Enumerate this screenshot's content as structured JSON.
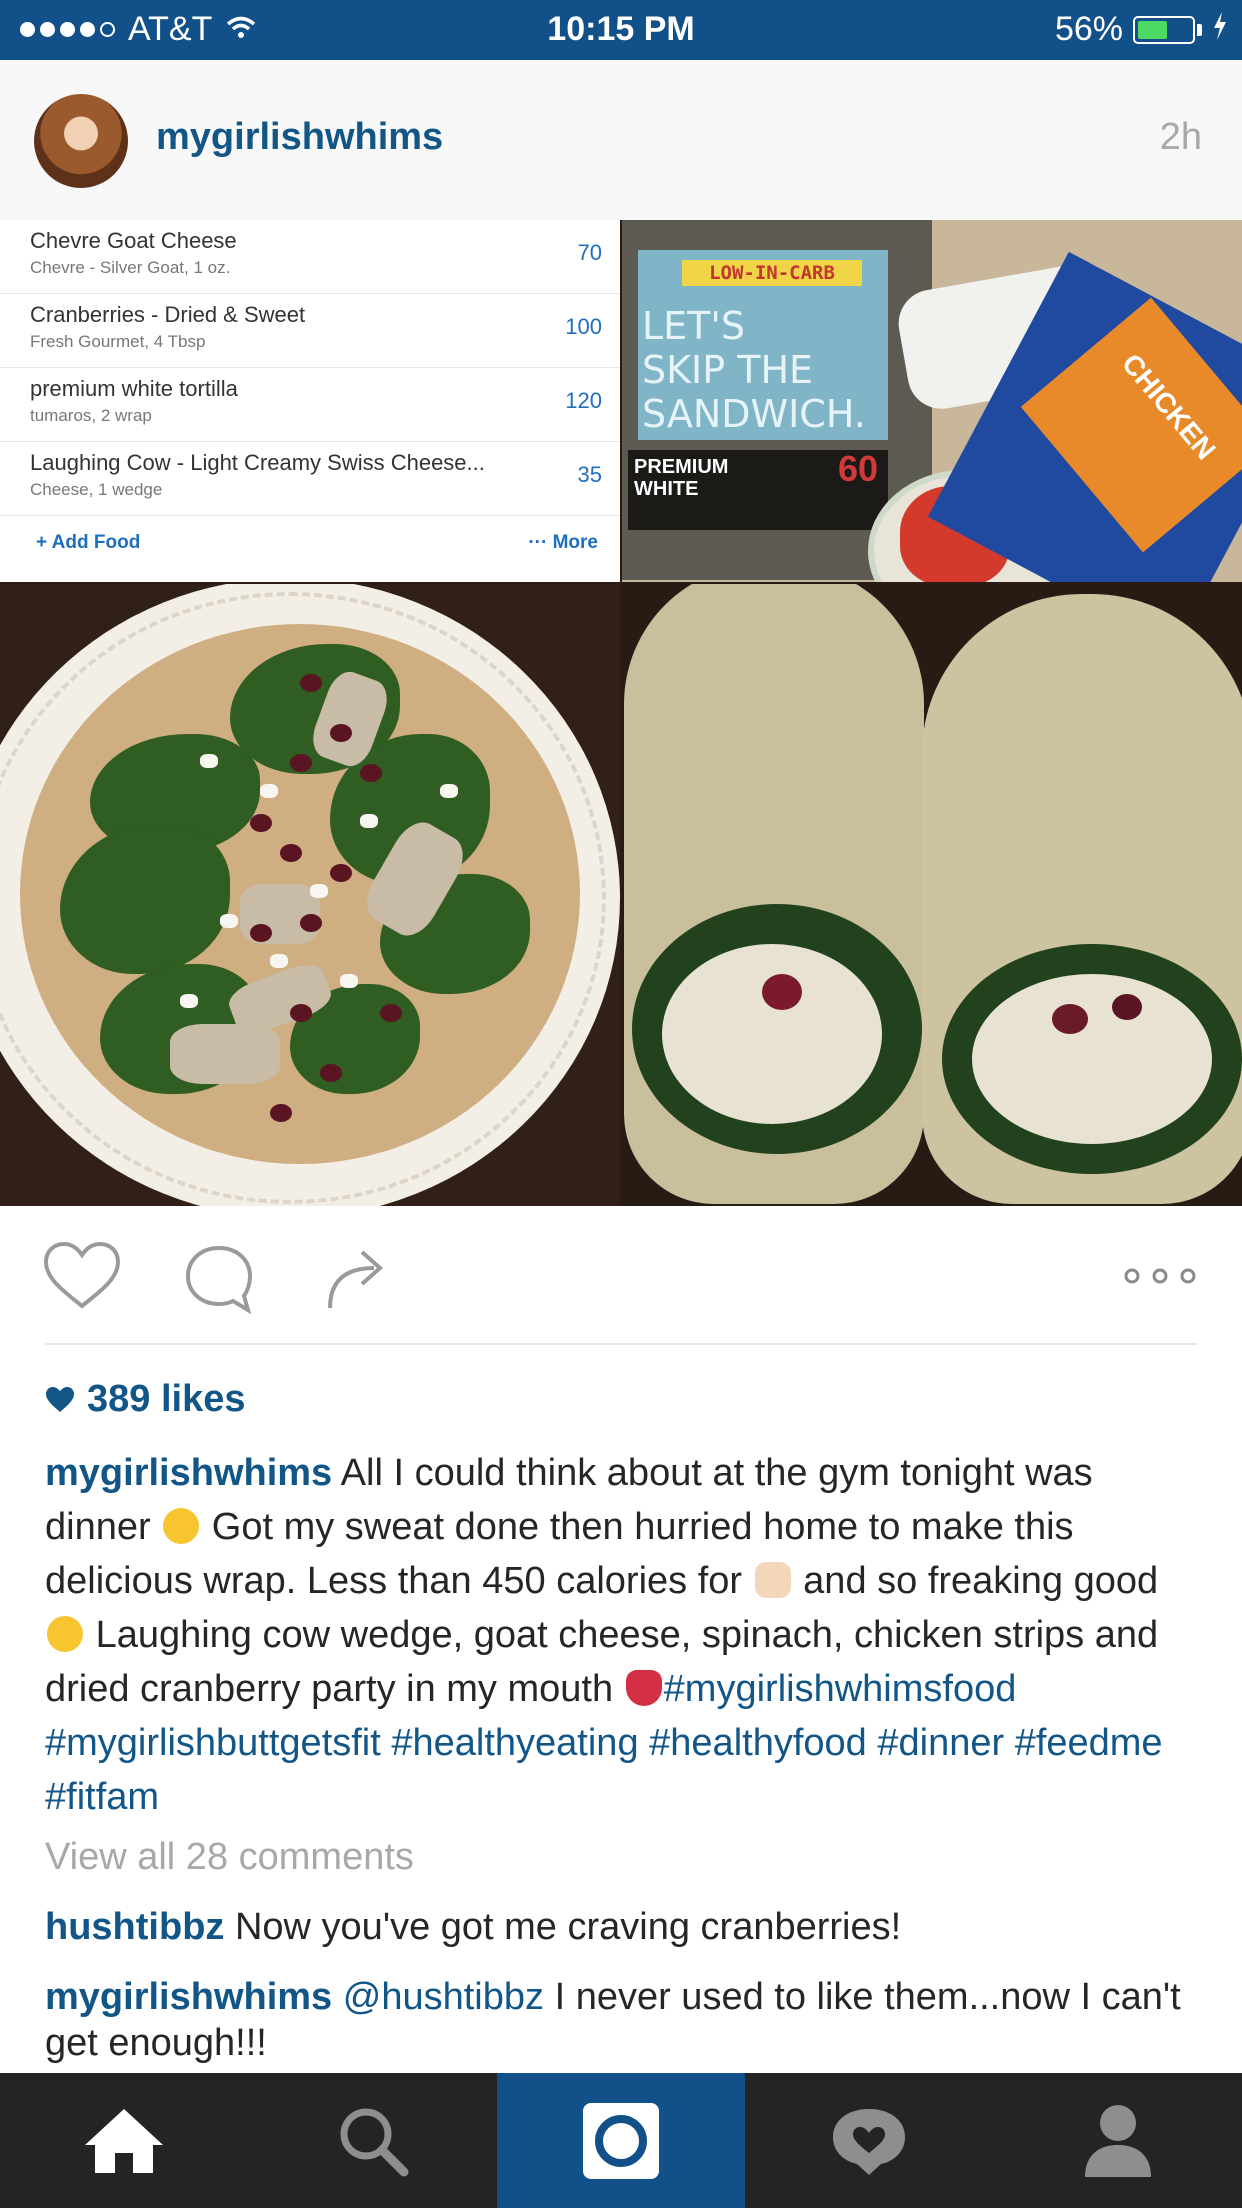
{
  "status_bar": {
    "carrier": "AT&T",
    "time": "10:15 PM",
    "battery_percent": "56%",
    "battery_level": 0.56,
    "signal_dots_filled": 4,
    "signal_dots_total": 5
  },
  "post": {
    "username": "mygirlishwhims",
    "time_ago": "2h"
  },
  "collage": {
    "food_log": [
      {
        "name": "Chevre Goat Cheese",
        "detail": "Chevre - Silver Goat, 1 oz.",
        "calories": "70"
      },
      {
        "name": "Cranberries - Dried & Sweet",
        "detail": "Fresh Gourmet, 4 Tbsp",
        "calories": "100"
      },
      {
        "name": "premium white tortilla",
        "detail": "tumaros, 2 wrap",
        "calories": "120"
      },
      {
        "name": "Laughing Cow - Light Creamy Swiss Cheese...",
        "detail": "Cheese, 1 wedge",
        "calories": "35"
      }
    ],
    "add_food": "+ Add Food",
    "more": "··· More",
    "package_texts": {
      "low_carb": "LOW-IN-CARB",
      "skip_line1": "LET'S",
      "skip_line2": "SKIP THE",
      "skip_line3": "SANDWICH.",
      "premium_line1": "PREMIUM",
      "premium_line2": "WHITE",
      "sixty": "60",
      "chicken": "CHICKEN"
    }
  },
  "actions": {
    "like": "heart-icon",
    "comment": "comment-icon",
    "share": "share-arrow-icon",
    "more": "more-dots-icon"
  },
  "likes": "389 likes",
  "caption": {
    "username": "mygirlishwhims",
    "part1": "All I could think about at the gym tonight was dinner",
    "part2": "Got my sweat done then hurried home to make this delicious wrap. Less than 450 calories for",
    "part3": "and so freaking good",
    "part4": "Laughing cow wedge, goat cheese, spinach, chicken strips and dried cranberry party in my mouth",
    "hashtags": [
      "#mygirlishwhimsfood",
      "#mygirlishbuttgetsfit",
      "#healthyeating",
      "#healthyfood",
      "#dinner",
      "#feedme",
      "#fitfam"
    ]
  },
  "view_all_comments": "View all 28 comments",
  "comments": [
    {
      "username": "hushtibbz",
      "mention": "",
      "text": "Now you've got me craving cranberries!"
    },
    {
      "username": "mygirlishwhims",
      "mention": "@hushtibbz",
      "text": "I never used to like them...now I can't get enough!!!"
    }
  ],
  "tab_bar": [
    "home-icon",
    "search-icon",
    "camera-icon",
    "activity-icon",
    "profile-icon"
  ],
  "colors": {
    "brand_blue": "#12508a",
    "link_blue": "#125688",
    "tab_bar_bg": "#242424",
    "muted_gray": "#a8a8a8"
  }
}
